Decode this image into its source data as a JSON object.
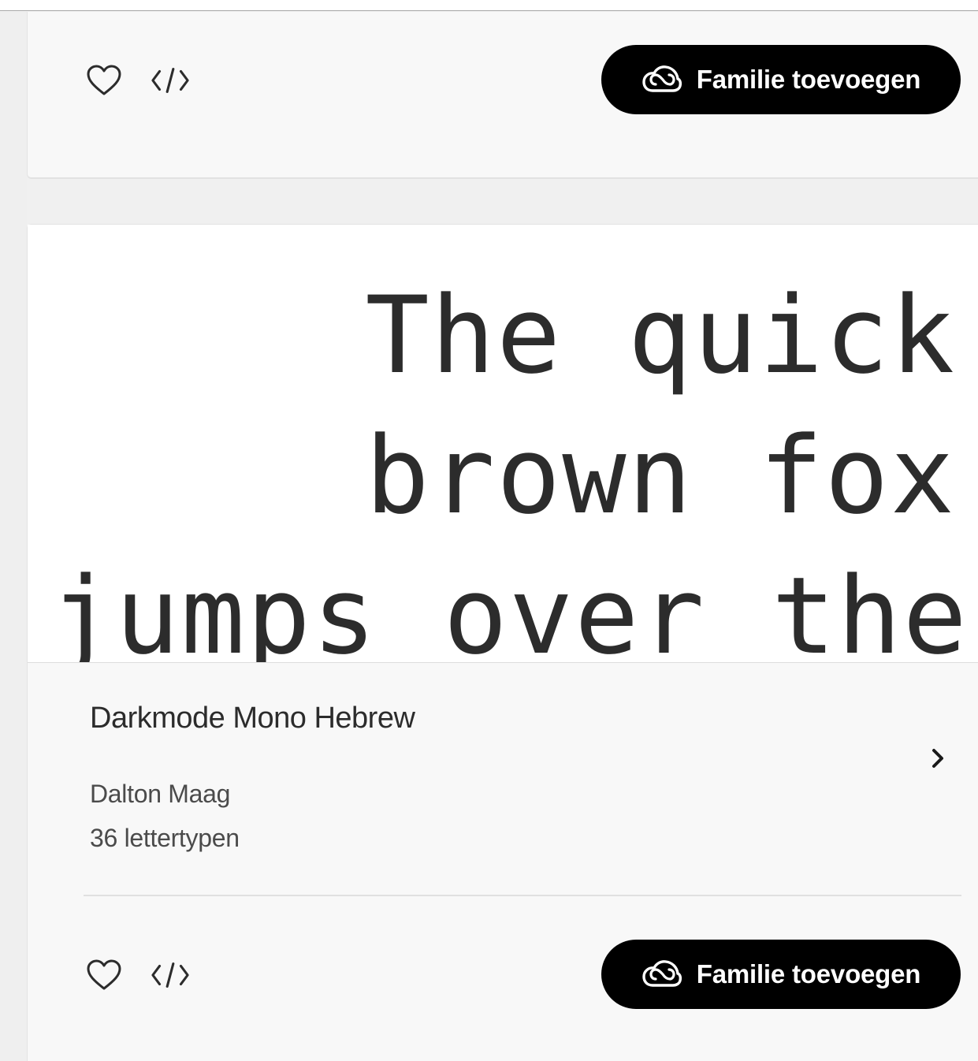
{
  "card_previous": {
    "add_button_label": "Familie toevoegen"
  },
  "card_current": {
    "preview_lines": [
      "The quick",
      "brown fox",
      "jumps over the"
    ],
    "family_name": "Darkmode Mono Hebrew",
    "foundry": "Dalton Maag",
    "font_count": "36 lettertypen",
    "add_button_label": "Familie toevoegen"
  },
  "icons": {
    "favorite": "heart-icon",
    "embed": "code-icon",
    "creative_cloud": "creative-cloud-icon",
    "details": "chevron-right-icon"
  },
  "colors": {
    "button_bg": "#000000",
    "button_text": "#ffffff",
    "card_bg": "#f8f8f8",
    "preview_bg": "#ffffff",
    "text": "#2c2c2c"
  }
}
